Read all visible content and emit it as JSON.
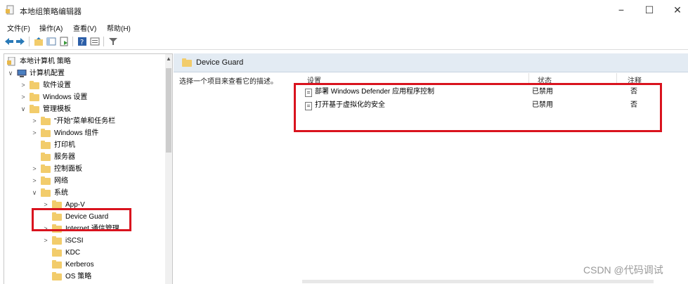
{
  "window": {
    "title": "本地组策略编辑器",
    "minimize": "−",
    "maximize": "☐",
    "close": "✕"
  },
  "menu": [
    "文件(F)",
    "操作(A)",
    "查看(V)",
    "帮助(H)"
  ],
  "tree": {
    "root": "本地计算机 策略",
    "computer_config": "计算机配置",
    "items": [
      "软件设置",
      "Windows 设置",
      "管理模板",
      "\"开始\"菜单和任务栏",
      "Windows 组件",
      "打印机",
      "服务器",
      "控制面板",
      "网络",
      "系统",
      "App-V",
      "Device Guard",
      "Internet 通信管理",
      "iSCSI",
      "KDC",
      "Kerberos",
      "OS 策略"
    ]
  },
  "right": {
    "header_title": "Device Guard",
    "description": "选择一个项目来查看它的描述。",
    "columns": {
      "setting": "设置",
      "state": "状态",
      "comment": "注释"
    },
    "rows": [
      {
        "name": "部署 Windows Defender 应用程序控制",
        "state": "已禁用",
        "comment": "否"
      },
      {
        "name": "打开基于虚拟化的安全",
        "state": "已禁用",
        "comment": "否"
      }
    ]
  },
  "colors": {
    "highlight": "#d9131e",
    "folder": "#f2cc6b",
    "header_bg": "#e3ebf3"
  },
  "watermark": "CSDN @代码调试"
}
